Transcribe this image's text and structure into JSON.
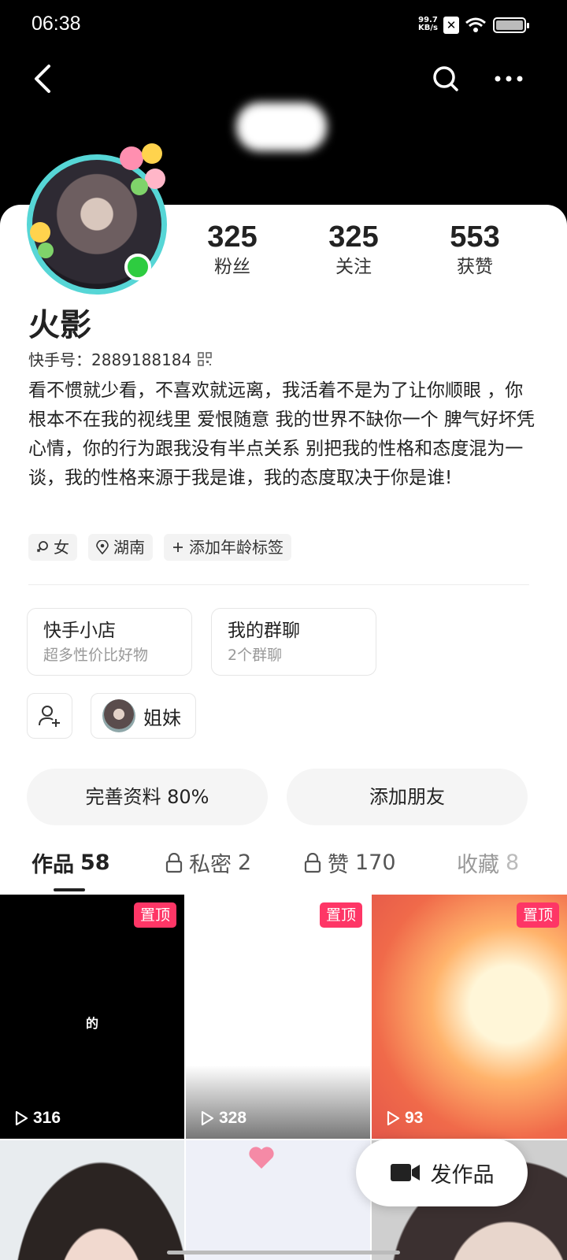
{
  "status_bar": {
    "time": "06:38",
    "net_speed_value": "99.7",
    "net_speed_unit": "KB/s"
  },
  "profile": {
    "name": "火影",
    "kuaishou_id_label": "快手号：2889188184",
    "bio": "看不惯就少看，不喜欢就远离，我活着不是为了让你顺眼 ，你根本不在我的视线里 爱恨随意 我的世界不缺你一个 脾气好坏凭心情，你的行为跟我没有半点关系 别把我的性格和态度混为一谈，我的性格来源于我是谁，我的态度取决于你是谁!",
    "stats": [
      {
        "num": "325",
        "label": "粉丝"
      },
      {
        "num": "325",
        "label": "关注"
      },
      {
        "num": "553",
        "label": "获赞"
      }
    ],
    "tags": [
      {
        "icon": "female-icon",
        "label": "女"
      },
      {
        "icon": "location-icon",
        "label": "湖南"
      },
      {
        "icon": "plus-icon",
        "label": "添加年龄标签"
      }
    ]
  },
  "cards": [
    {
      "title": "快手小店",
      "subtitle": "超多性价比好物"
    },
    {
      "title": "我的群聊",
      "subtitle": "2个群聊"
    }
  ],
  "sister_label": "姐妹",
  "buttons": {
    "complete_profile": "完善资料 80%",
    "add_friend": "添加朋友"
  },
  "tabs": [
    {
      "label": "作品",
      "count": "58",
      "locked": false,
      "active": true
    },
    {
      "label": "私密",
      "count": "2",
      "locked": true,
      "active": false
    },
    {
      "label": "赞",
      "count": "170",
      "locked": true,
      "active": false
    },
    {
      "label": "收藏",
      "count": "8",
      "locked": false,
      "active": false
    }
  ],
  "videos": [
    {
      "pin": "置顶",
      "plays": "316",
      "overlay": "的"
    },
    {
      "pin": "置顶",
      "plays": "328"
    },
    {
      "pin": "置顶",
      "plays": "93"
    }
  ],
  "fab_label": "发作品",
  "colors": {
    "accent_pin": "#fe3666",
    "online": "#2ecc40",
    "avatar_ring": "#56d6d6"
  }
}
